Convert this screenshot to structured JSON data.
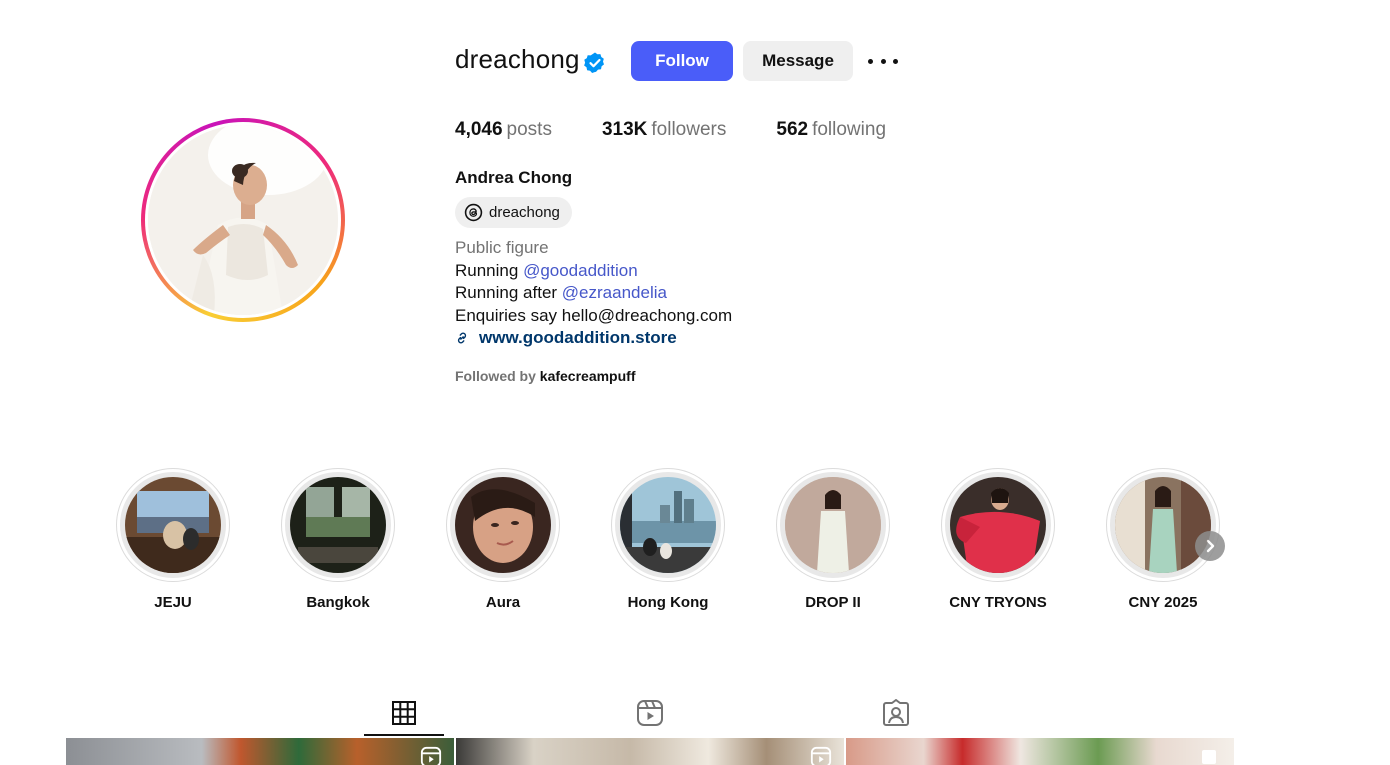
{
  "profile": {
    "username": "dreachong",
    "verified": true,
    "follow_label": "Follow",
    "message_label": "Message",
    "stats": {
      "posts_count": "4,046",
      "posts_label": "posts",
      "followers_count": "313K",
      "followers_label": "followers",
      "following_count": "562",
      "following_label": "following"
    },
    "full_name": "Andrea Chong",
    "threads_handle": "dreachong",
    "category": "Public figure",
    "bio_line1_prefix": "Running ",
    "bio_line1_mention": "@goodaddition",
    "bio_line2_prefix": "Running after ",
    "bio_line2_mention": "@ezraandelia",
    "bio_line3": "Enquiries say hello@dreachong.com",
    "website": "www.goodaddition.store",
    "followed_by_prefix": "Followed by ",
    "followed_by_user": "kafecreampuff"
  },
  "highlights": [
    {
      "label": "JEJU"
    },
    {
      "label": "Bangkok"
    },
    {
      "label": "Aura"
    },
    {
      "label": "Hong Kong"
    },
    {
      "label": "DROP II"
    },
    {
      "label": "CNY TRYONS"
    },
    {
      "label": "CNY 2025"
    }
  ],
  "tabs": [
    {
      "name": "posts",
      "icon": "grid-icon",
      "active": true
    },
    {
      "name": "reels",
      "icon": "reels-icon",
      "active": false
    },
    {
      "name": "tagged",
      "icon": "tagged-icon",
      "active": false
    }
  ],
  "colors": {
    "follow_button": "#4a5df9",
    "verified_badge": "#0095f6",
    "mention_link": "#4657c9",
    "website_link": "#00376b",
    "secondary_text": "#737373"
  }
}
